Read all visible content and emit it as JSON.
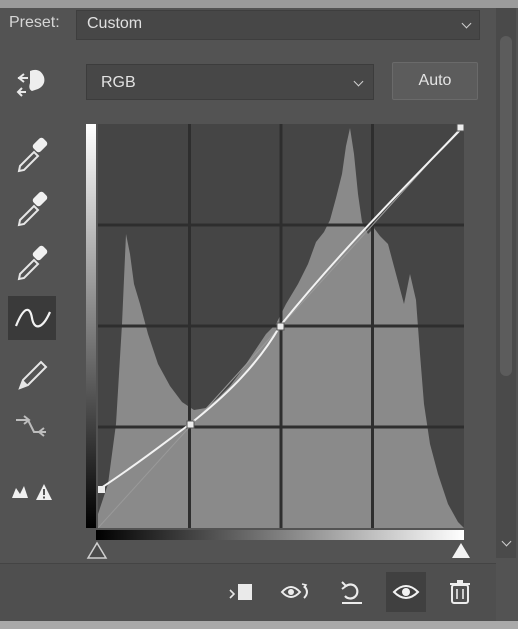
{
  "preset": {
    "label": "Preset:",
    "value": "Custom",
    "icon": "chevron-down-icon"
  },
  "channel": {
    "value": "RGB",
    "icon": "chevron-down-icon"
  },
  "auto_button": {
    "label": "Auto"
  },
  "tools": [
    {
      "name": "on-image-adjustment-icon",
      "active": false
    },
    {
      "name": "black-point-eyedropper-icon",
      "active": false
    },
    {
      "name": "gray-point-eyedropper-icon",
      "active": false
    },
    {
      "name": "white-point-eyedropper-icon",
      "active": false
    },
    {
      "name": "curve-point-tool-icon",
      "active": true
    },
    {
      "name": "pencil-draw-icon",
      "active": false
    },
    {
      "name": "smooth-curve-icon",
      "active": false
    },
    {
      "name": "clipping-warning-icon",
      "active": false
    }
  ],
  "bottom_icons": [
    "clip-to-layer-icon",
    "view-previous-state-icon",
    "reset-icon",
    "visibility-eye-icon",
    "delete-icon"
  ],
  "colors": {
    "panel_bg": "#535353",
    "field_bg": "#474747",
    "text": "#e0e0e0",
    "histogram": "#8a8a8a",
    "graph_bg": "#454545"
  }
}
